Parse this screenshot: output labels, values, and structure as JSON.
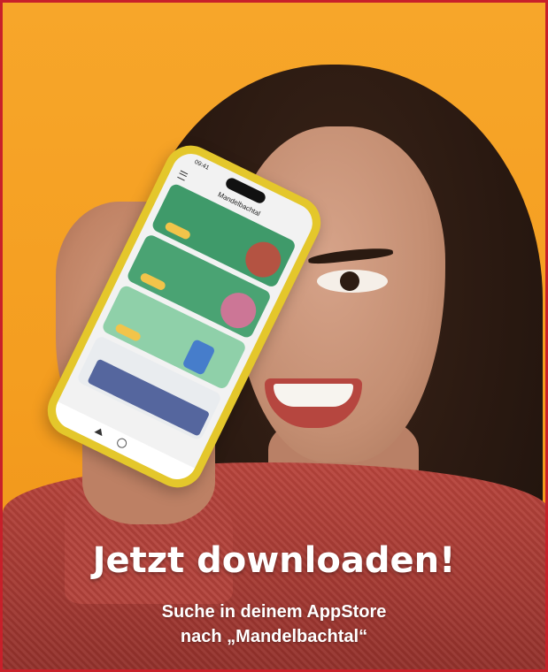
{
  "poster": {
    "headline": "Jetzt downloaden!",
    "subline_1": "Suche in deinem AppStore",
    "subline_2": "nach „Mandelbachtal“"
  },
  "phone": {
    "app_title": "Mandelbachtal",
    "status_time": "09:41"
  },
  "colors": {
    "background": "#f49d1f",
    "border": "#c8202a",
    "phone_case": "#e4c72b",
    "sweater": "#a53a33"
  }
}
